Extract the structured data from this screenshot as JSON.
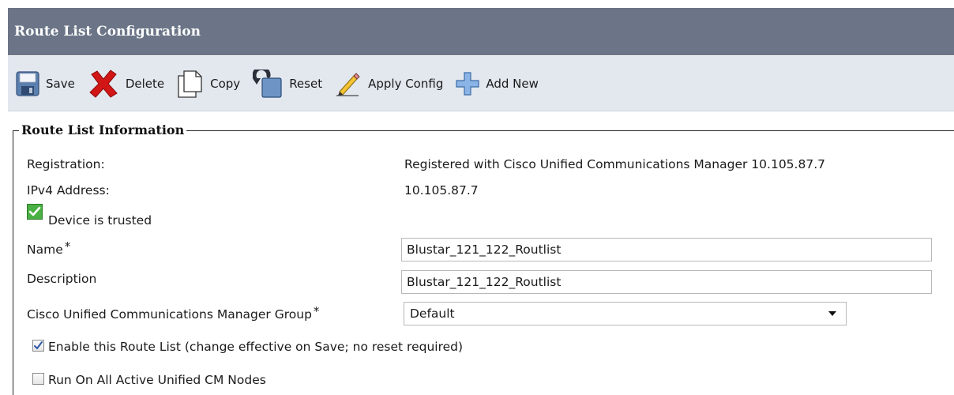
{
  "header": {
    "title": "Route List Configuration"
  },
  "toolbar": {
    "buttons": [
      {
        "label": "Save",
        "icon": "save-icon"
      },
      {
        "label": "Delete",
        "icon": "delete-icon"
      },
      {
        "label": "Copy",
        "icon": "copy-icon"
      },
      {
        "label": "Reset",
        "icon": "reset-icon"
      },
      {
        "label": "Apply Config",
        "icon": "pencil-icon"
      },
      {
        "label": "Add New",
        "icon": "add-icon"
      }
    ]
  },
  "section": {
    "title": "Route List Information",
    "registration_label": "Registration:",
    "registration_value": "Registered with Cisco Unified Communications Manager 10.105.87.7",
    "ipv4_label": "IPv4 Address:",
    "ipv4_value": "10.105.87.7",
    "trusted_text": "Device is trusted",
    "name_label": "Name",
    "name_value": "Blustar_121_122_Routlist",
    "description_label": "Description",
    "description_value": "Blustar_121_122_Routlist",
    "cm_group_label": "Cisco Unified Communications Manager Group",
    "cm_group_value": "Default",
    "required_marker": "*",
    "enable_label": "Enable this Route List (change effective on Save; no reset required)",
    "enable_checked": true,
    "run_all_label": "Run On All Active Unified CM Nodes",
    "run_all_checked": false
  },
  "colors": {
    "title_bar": "#6b7587",
    "toolbar_bg": "#e3e8ef",
    "trusted_green": "#3aa535"
  }
}
